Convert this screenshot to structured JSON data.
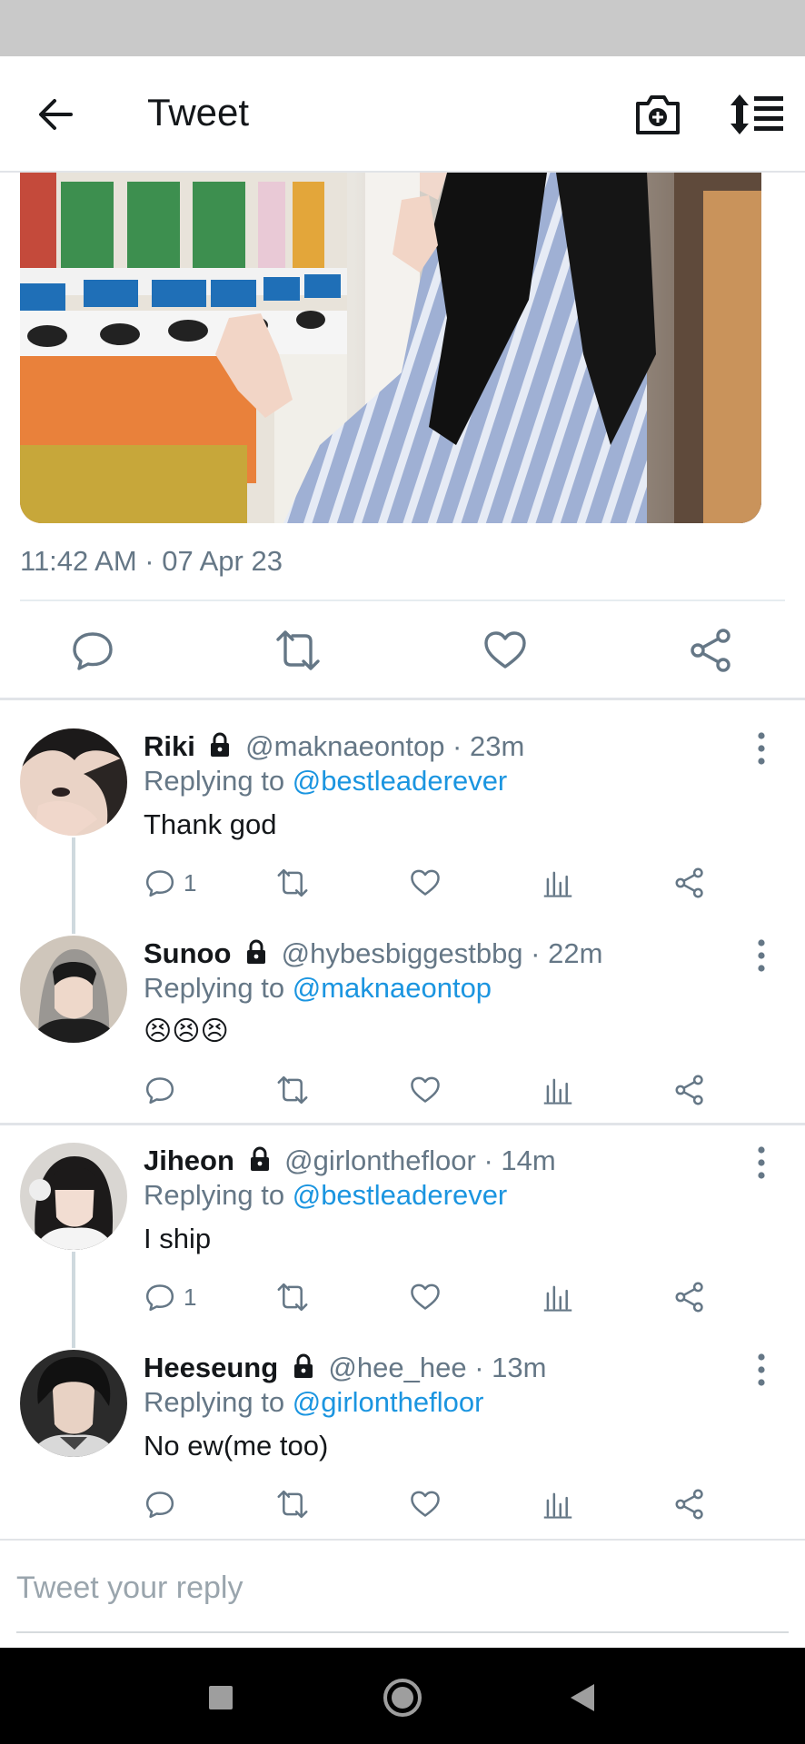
{
  "header": {
    "title": "Tweet",
    "back_icon": "arrow-left-icon",
    "camera_icon": "camera-plus-icon",
    "sort_icon": "sort-list-icon"
  },
  "tweet": {
    "timestamp": "11:42 AM · 07 Apr 23",
    "image_alt": "Person in striped shirt leaning on vending machine"
  },
  "colors": {
    "link": "#1b95e0",
    "muted": "#657786",
    "text": "#14171a"
  },
  "replies": [
    {
      "name": "Riki",
      "handle": "@maknaeontop · 23m",
      "replying_label": "Replying to",
      "replying_to": "@bestleaderever",
      "text": "Thank god",
      "reply_count": "1"
    },
    {
      "name": "Sunoo",
      "handle": "@hybesbiggestbbg · 22m",
      "replying_label": "Replying to",
      "replying_to": "@maknaeontop",
      "text": "😣😣😣",
      "reply_count": ""
    },
    {
      "name": "Jiheon",
      "handle": "@girlonthefloor · 14m",
      "replying_label": "Replying to",
      "replying_to": "@bestleaderever",
      "text": "I ship",
      "reply_count": "1"
    },
    {
      "name": "Heeseung",
      "handle": "@hee_hee · 13m",
      "replying_label": "Replying to",
      "replying_to": "@girlonthefloor",
      "text": "No ew(me too)",
      "reply_count": ""
    }
  ],
  "compose": {
    "placeholder": "Tweet your reply"
  }
}
